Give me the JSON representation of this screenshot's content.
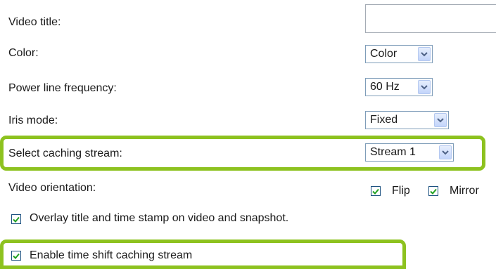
{
  "video_title": {
    "label": "Video title:",
    "value": ""
  },
  "color": {
    "label": "Color:",
    "selected": "Color"
  },
  "power_line_frequency": {
    "label": "Power line frequency:",
    "selected": "60 Hz"
  },
  "iris_mode": {
    "label": "Iris mode:",
    "selected": "Fixed"
  },
  "caching_stream": {
    "label": "Select caching stream:",
    "selected": "Stream 1"
  },
  "video_orientation": {
    "label": "Video orientation:",
    "flip_label": "Flip",
    "flip_checked": true,
    "mirror_label": "Mirror",
    "mirror_checked": true
  },
  "overlay": {
    "label": "Overlay title and time stamp on video and snapshot.",
    "checked": true
  },
  "time_shift": {
    "label": "Enable time shift caching stream",
    "checked": true
  },
  "colors": {
    "highlight": "#8dc21f",
    "checkmark": "#21a121",
    "arrow": "#4d6185"
  },
  "icons": {
    "dropdown": "chevron-down-icon",
    "check": "checkmark-icon"
  }
}
